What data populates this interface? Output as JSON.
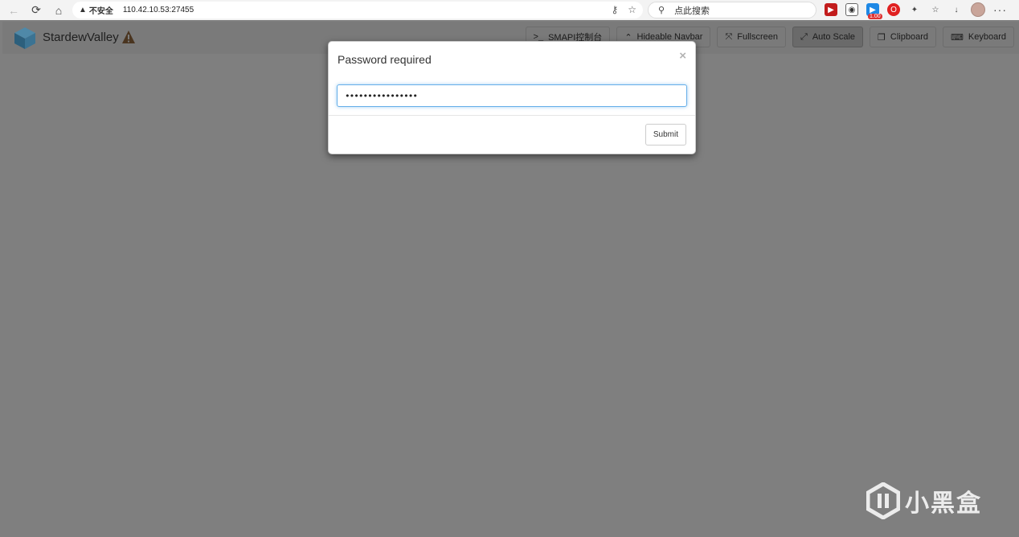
{
  "browser": {
    "security_label": "不安全",
    "url": "110.42.10.53:27455",
    "search_placeholder": "点此搜索",
    "ext_badge": "1.00"
  },
  "app": {
    "brand": "StardewValley",
    "nav_buttons": [
      {
        "label": "SMAPI控制台",
        "icon": "terminal-icon"
      },
      {
        "label": "Hideable Navbar",
        "icon": "chevron-up-icon"
      },
      {
        "label": "Fullscreen",
        "icon": "expand-icon"
      },
      {
        "label": "Auto Scale",
        "icon": "resize-icon",
        "active": true
      },
      {
        "label": "Clipboard",
        "icon": "clipboard-icon"
      },
      {
        "label": "Keyboard",
        "icon": "keyboard-icon"
      }
    ]
  },
  "modal": {
    "title": "Password required",
    "close_symbol": "×",
    "password_value": "••••••••••••••••",
    "submit_label": "Submit"
  },
  "watermark": {
    "text": "小黑盒"
  }
}
